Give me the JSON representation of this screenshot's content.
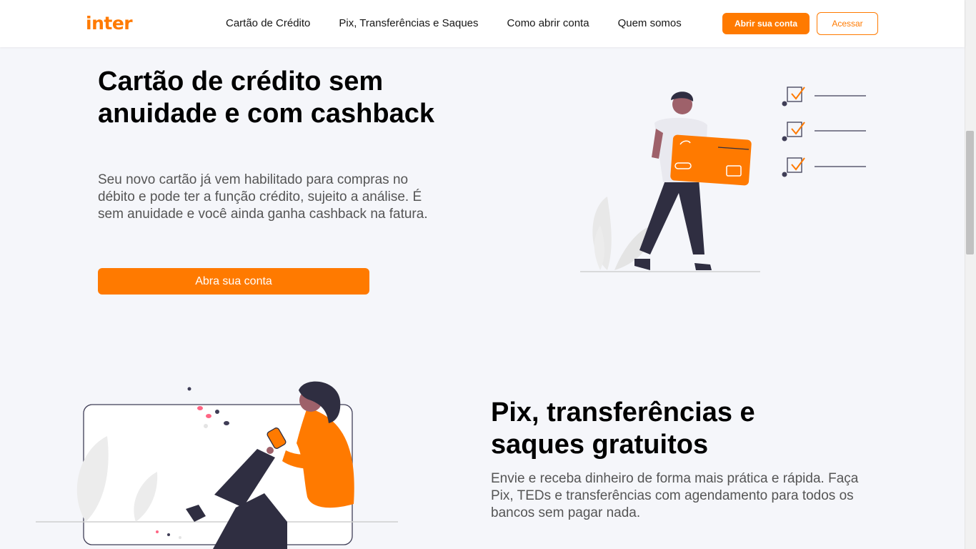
{
  "header": {
    "logo_text": "inter",
    "nav": [
      {
        "label": "Cartão de Crédito"
      },
      {
        "label": "Pix, Transferências e Saques"
      },
      {
        "label": "Como abrir conta"
      },
      {
        "label": "Quem somos"
      }
    ],
    "open_account_label": "Abrir sua conta",
    "access_label": "Acessar"
  },
  "hero": {
    "title": "Cartão de crédito sem anuidade e com cashback",
    "text": "Seu novo cartão já vem habilitado para compras no débito e pode ter a função crédito, sujeito a análise. É sem anuidade e você ainda ganha cashback na fatura.",
    "cta_label": "Abra sua conta",
    "illustration": "person-holding-credit-card"
  },
  "pix": {
    "title": "Pix, transferências e saques gratuitos",
    "text": "Envie e receba dinheiro de forma mais prática e rápida. Faça Pix, TEDs e transferências com agendamento para todos os bancos sem pagar nada.",
    "illustration": "woman-using-phone"
  },
  "colors": {
    "brand": "#ff7a00",
    "background": "#f5f6fa",
    "text": "#161616",
    "muted": "#555555"
  }
}
